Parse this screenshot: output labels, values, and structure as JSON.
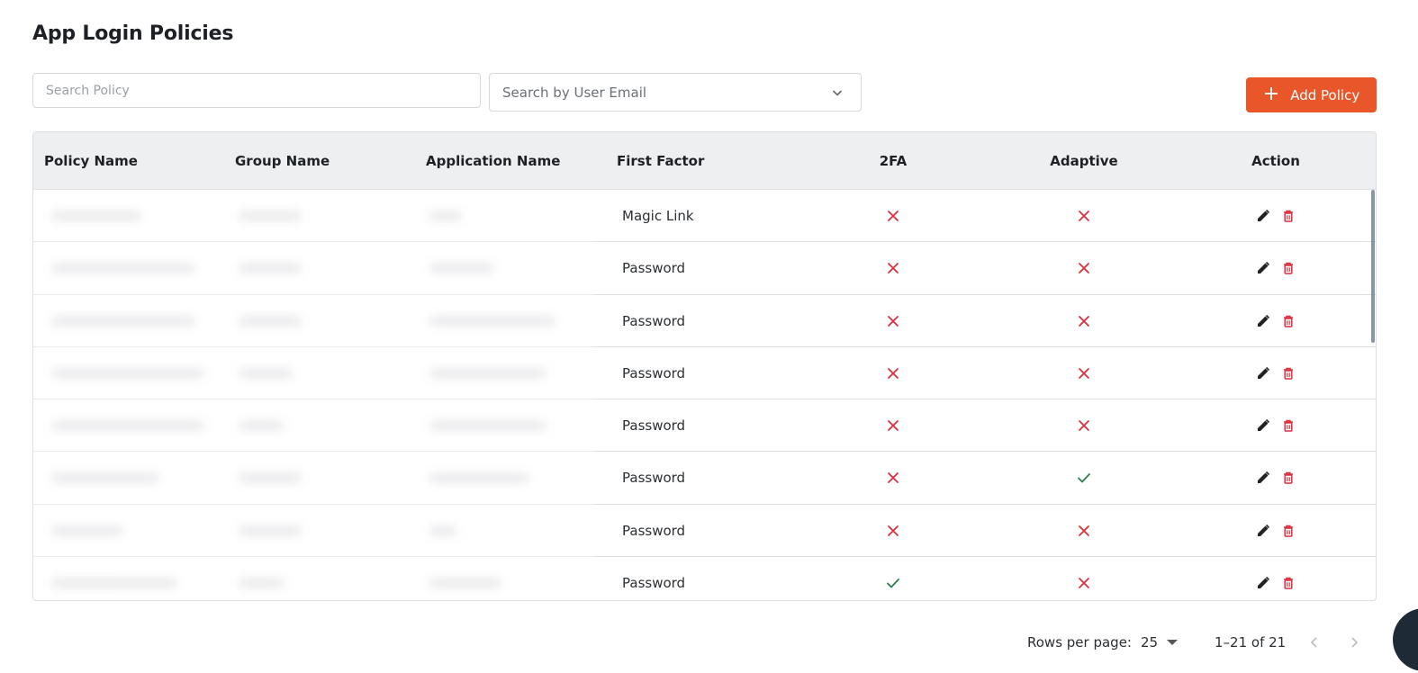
{
  "page": {
    "title": "App Login Policies"
  },
  "search": {
    "placeholder": "Search Policy"
  },
  "email_filter": {
    "placeholder": "Search by User Email"
  },
  "add_button": {
    "label": "Add Policy"
  },
  "table": {
    "columns": [
      "Policy Name",
      "Group Name",
      "Application Name",
      "First Factor",
      "2FA",
      "Adaptive",
      "Action"
    ],
    "rows": [
      {
        "first_factor": "Magic Link",
        "twofa": false,
        "adaptive": false
      },
      {
        "first_factor": "Password",
        "twofa": false,
        "adaptive": false
      },
      {
        "first_factor": "Password",
        "twofa": false,
        "adaptive": false
      },
      {
        "first_factor": "Password",
        "twofa": false,
        "adaptive": false
      },
      {
        "first_factor": "Password",
        "twofa": false,
        "adaptive": false
      },
      {
        "first_factor": "Password",
        "twofa": false,
        "adaptive": true
      },
      {
        "first_factor": "Password",
        "twofa": false,
        "adaptive": false
      },
      {
        "first_factor": "Password",
        "twofa": true,
        "adaptive": false
      }
    ]
  },
  "pagination": {
    "rows_per_page_label": "Rows per page:",
    "rows_per_page": "25",
    "range": "1–21 of 21"
  },
  "colors": {
    "accent": "#e8562a",
    "cross": "#d9303e",
    "check": "#2e7d4f",
    "delete": "#d9303e"
  }
}
